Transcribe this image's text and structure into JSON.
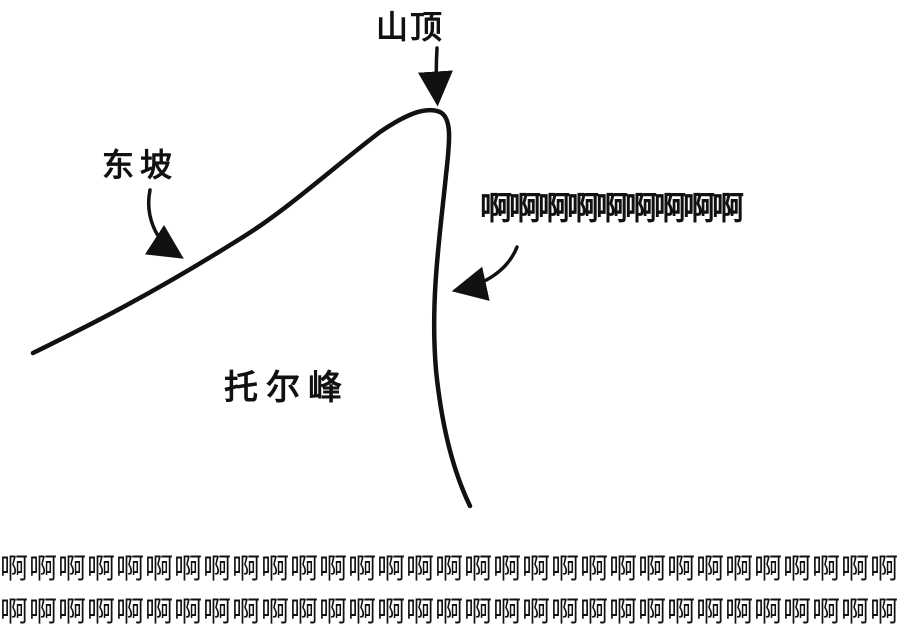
{
  "labels": {
    "summit": "山顶",
    "east_slope": "东坡",
    "cliff_scream": "啊啊啊啊啊啊啊啊啊",
    "peak_name": "托尔峰"
  },
  "bottom_text": {
    "line1": "啊啊啊啊啊啊啊啊啊啊啊啊啊啊啊啊啊啊啊啊啊啊啊啊啊啊啊啊啊啊啊",
    "line2": "啊啊啊啊啊啊啊啊啊啊啊啊啊啊啊啊啊啊啊啊啊啊啊啊啊啊啊啊啊啊啊"
  },
  "colors": {
    "ink": "#111111",
    "background": "#ffffff"
  }
}
